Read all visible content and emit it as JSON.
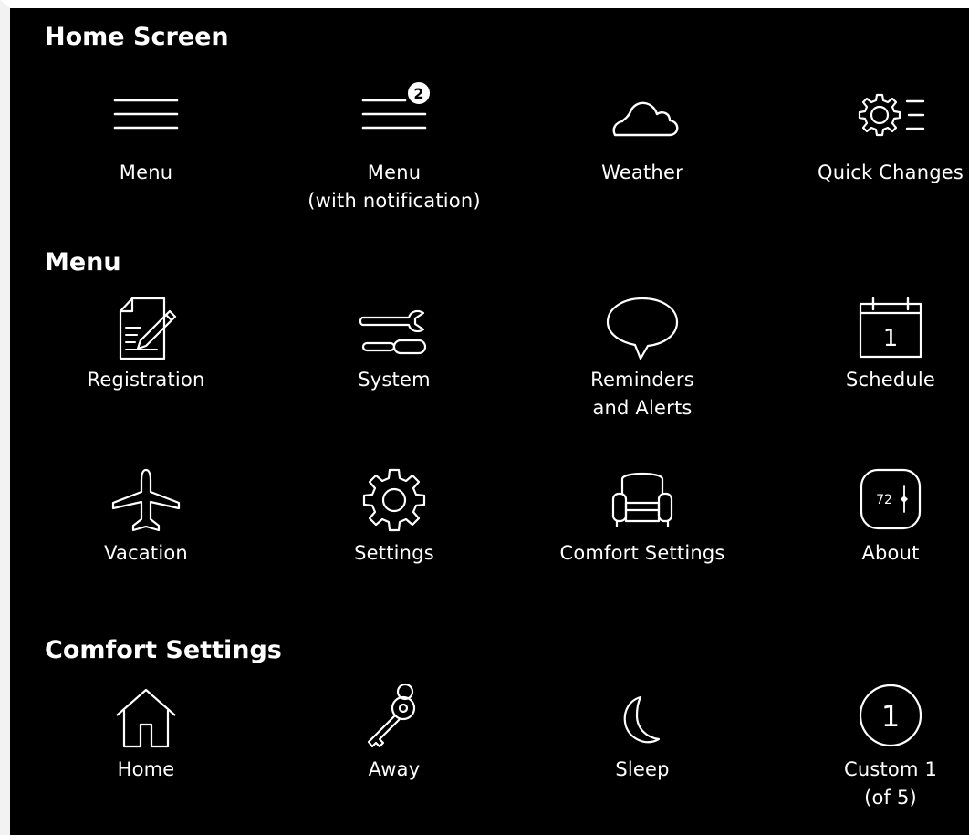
{
  "sections": {
    "home_screen": {
      "title": "Home Screen",
      "items": [
        {
          "label": "Menu",
          "icon": "hamburger-menu-icon"
        },
        {
          "label": "Menu\n(with notification)",
          "icon": "menu-notification-icon",
          "badge": "2"
        },
        {
          "label": "Weather",
          "icon": "cloud-icon"
        },
        {
          "label": "Quick Changes",
          "icon": "gear-list-icon"
        }
      ]
    },
    "menu": {
      "title": "Menu",
      "items": [
        {
          "label": "Registration",
          "icon": "document-pencil-icon"
        },
        {
          "label": "System",
          "icon": "wrench-screwdriver-icon"
        },
        {
          "label": "Reminders\nand Alerts",
          "icon": "speech-bubble-icon"
        },
        {
          "label": "Schedule",
          "icon": "calendar-icon",
          "calendar_day": "1"
        },
        {
          "label": "Vacation",
          "icon": "airplane-icon"
        },
        {
          "label": "Settings",
          "icon": "gear-icon"
        },
        {
          "label": "Comfort Settings",
          "icon": "armchair-icon"
        },
        {
          "label": "About",
          "icon": "thermostat-icon",
          "thermostat_value": "72"
        }
      ]
    },
    "comfort_settings": {
      "title": "Comfort Settings",
      "items": [
        {
          "label": "Home",
          "icon": "house-icon"
        },
        {
          "label": "Away",
          "icon": "key-icon"
        },
        {
          "label": "Sleep",
          "icon": "moon-icon"
        },
        {
          "label": "Custom 1\n(of 5)",
          "icon": "numbered-circle-icon",
          "number": "1"
        }
      ]
    }
  },
  "colors": {
    "background": "#000000",
    "foreground": "#ffffff",
    "badge_text": "#000000"
  }
}
